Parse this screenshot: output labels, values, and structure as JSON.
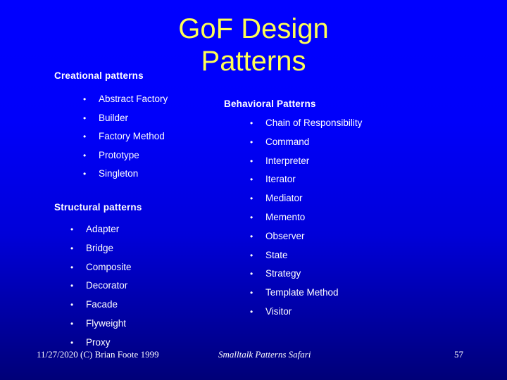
{
  "slide": {
    "title_line1": "GoF Design",
    "title_line2": "Patterns",
    "background_top_color": "#0000ff",
    "background_bottom_color": "#000078",
    "title_color": "#ffff55",
    "body_text_color": "#ffffff"
  },
  "creational": {
    "heading": "Creational patterns",
    "bullet_glyph": "•",
    "items": [
      {
        "label": "Abstract Factory"
      },
      {
        "label": "Builder"
      },
      {
        "label": "Factory Method"
      },
      {
        "label": "Prototype"
      },
      {
        "label": "Singleton"
      }
    ]
  },
  "structural": {
    "heading": "Structural patterns",
    "bullet_glyph": "•",
    "items": [
      {
        "label": "Adapter"
      },
      {
        "label": "Bridge"
      },
      {
        "label": "Composite"
      },
      {
        "label": "Decorator"
      },
      {
        "label": "Facade"
      },
      {
        "label": "Flyweight"
      },
      {
        "label": "Proxy"
      }
    ]
  },
  "behavioral": {
    "heading": "Behavioral Patterns",
    "bullet_glyph": "•",
    "items": [
      {
        "label": "Chain of Responsibility"
      },
      {
        "label": "Command"
      },
      {
        "label": "Interpreter"
      },
      {
        "label": "Iterator"
      },
      {
        "label": "Mediator"
      },
      {
        "label": "Memento"
      },
      {
        "label": "Observer"
      },
      {
        "label": "State"
      },
      {
        "label": "Strategy"
      },
      {
        "label": "Template Method"
      },
      {
        "label": "Visitor"
      }
    ]
  },
  "footer": {
    "date_and_copyright": "11/27/2020 (C) Brian Foote 1999",
    "center_title": "Smalltalk Patterns Safari",
    "page_number": "57"
  }
}
